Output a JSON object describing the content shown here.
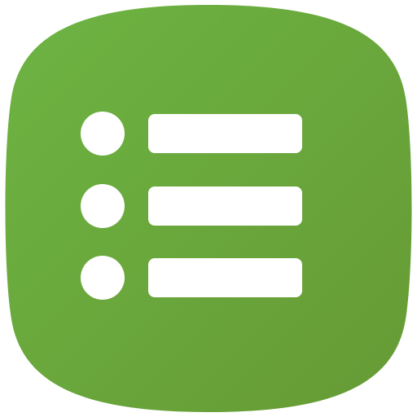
{
  "app_icon": {
    "icon": "list-icon",
    "colors": {
      "gradient_start": "#6db443",
      "gradient_end": "#669a34",
      "glyph": "#ffffff",
      "background": "#ffffff"
    },
    "rows": [
      {
        "bullet_icon": "bullet-dot",
        "bar_icon": "list-line"
      },
      {
        "bullet_icon": "bullet-dot",
        "bar_icon": "list-line"
      },
      {
        "bullet_icon": "bullet-dot",
        "bar_icon": "list-line"
      }
    ]
  }
}
